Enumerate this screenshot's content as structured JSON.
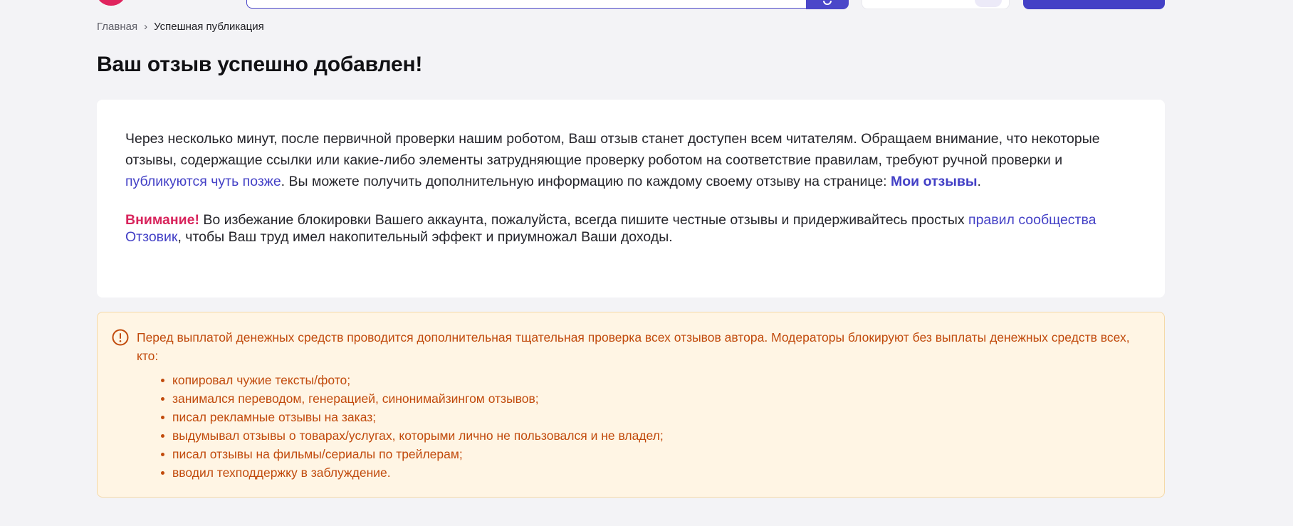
{
  "breadcrumb": {
    "home": "Главная",
    "separator": "›",
    "current": "Успешная публикация"
  },
  "page": {
    "title": "Ваш отзыв успешно добавлен!"
  },
  "info": {
    "p1_part1": "Через несколько минут, после первичной проверки нашим роботом, Ваш отзыв станет доступен всем читателям. Обращаем внимание, что некоторые отзывы, содержащие ссылки или какие-либо элементы затрудняющие проверку роботом на соответствие правилам, требуют ручной проверки и ",
    "p1_link": "публикуются чуть позже",
    "p1_part2": ". Вы можете получить дополнительную информацию по каждому своему отзыву на странице: ",
    "my_reviews_link": "Мои отзывы",
    "p1_end": ".",
    "attention_label": "Внимание!",
    "p2_part1": " Во избежание блокировки Вашего аккаунта, пожалуйста, всегда пишите честные отзывы и придерживайтесь простых ",
    "rules_link": "правил сообщества Отзовик",
    "p2_part2": ", чтобы Ваш труд имел накопительный эффект и приумножал Ваши доходы."
  },
  "alert": {
    "icon": "exclamation-circle-icon",
    "text": "Перед выплатой денежных средств проводится дополнительная тщательная проверка всех отзывов автора. Модераторы блокируют без выплаты денежных средств всех, кто:",
    "items": [
      "копировал чужие тексты/фото;",
      "занимался переводом, генерацией, синонимайзингом отзывов;",
      "писал рекламные отзывы на заказ;",
      "выдумывал отзывы о товарах/услугах, которыми лично не пользовался и не владел;",
      "писал отзывы на фильмы/сериалы по трейлерам;",
      "вводил техподдержку в заблуждение."
    ]
  },
  "colors": {
    "accent": "#4340c6",
    "brand": "#e0245e",
    "attention": "#d8245c",
    "alert_text": "#c14a0c",
    "alert_bg": "#fff5e4"
  }
}
